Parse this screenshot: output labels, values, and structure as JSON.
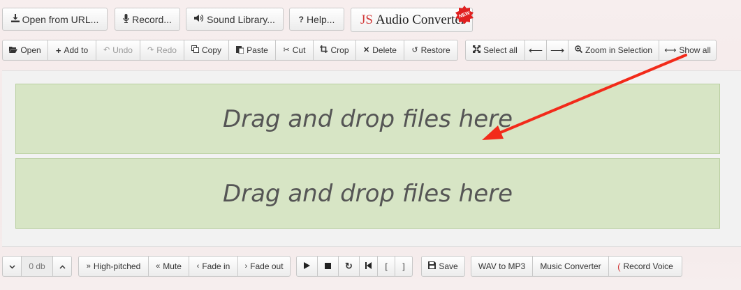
{
  "top_buttons": {
    "open_url": "Open from URL...",
    "record": "Record...",
    "sound_library": "Sound Library...",
    "help": "Help..."
  },
  "logo": {
    "js": "JS",
    "text": "Audio Converter",
    "badge": "NEW"
  },
  "toolbar": {
    "open": "Open",
    "add_to": "Add to",
    "undo": "Undo",
    "redo": "Redo",
    "copy": "Copy",
    "paste": "Paste",
    "cut": "Cut",
    "crop": "Crop",
    "delete": "Delete",
    "restore": "Restore",
    "select_all": "Select all",
    "zoom_selection": "Zoom in Selection",
    "show_all": "Show all"
  },
  "drop_zones": [
    "Drag and drop files here",
    "Drag and drop files here"
  ],
  "bottom": {
    "db_value": "0 db",
    "high_pitched": "High-pitched",
    "mute": "Mute",
    "fade_in": "Fade in",
    "fade_out": "Fade out",
    "bracket_open": "[",
    "bracket_close": "]",
    "save": "Save",
    "wav_to_mp3": "WAV to MP3",
    "music_converter": "Music Converter",
    "record_voice": "Record Voice"
  },
  "colors": {
    "accent_red": "#d23a3a",
    "drop_zone": "#d7e5c5",
    "arrow": "#f22a1a"
  }
}
